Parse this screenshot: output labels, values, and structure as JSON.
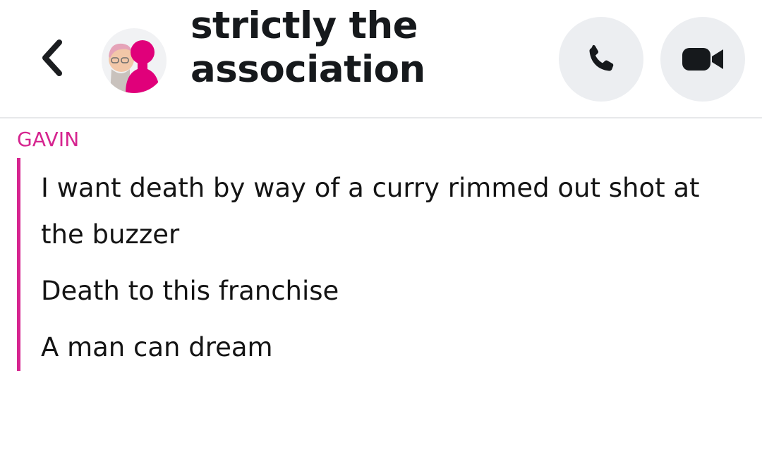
{
  "header": {
    "title_line1": "strictly the",
    "title_line2": "association",
    "back_icon": "chevron-left-icon",
    "call_icon": "phone-icon",
    "video_icon": "video-camera-icon"
  },
  "chat": {
    "sender": "GAVIN",
    "accent_color": "#d6248f",
    "messages": [
      {
        "text": "I want death by way of a curry rimmed out shot at the buzzer"
      },
      {
        "text": "Death to this franchise"
      },
      {
        "text": "A man can dream"
      }
    ]
  }
}
